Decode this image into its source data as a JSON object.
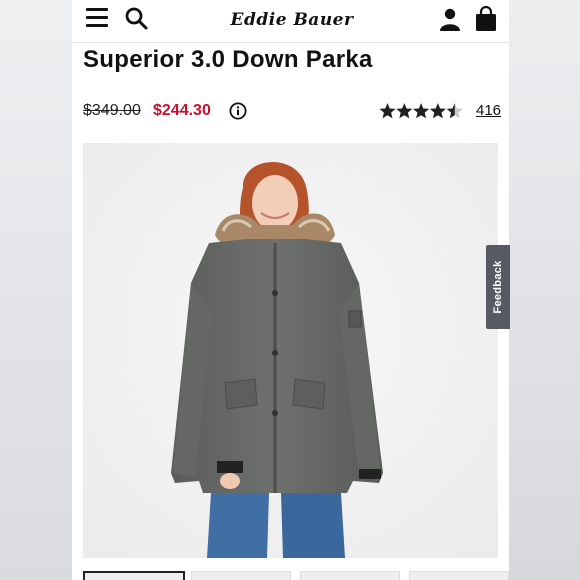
{
  "header": {
    "menu_icon": "hamburger-menu-icon",
    "search_icon": "search-icon",
    "logo_text": "Eddie Bauer",
    "account_icon": "person-icon",
    "bag_icon": "shopping-bag-icon"
  },
  "product": {
    "title": "Superior 3.0 Down Parka",
    "original_price": "$349.00",
    "sale_price": "$244.30",
    "sale_price_color": "#c8102e",
    "info_icon": "info-circle-icon",
    "rating": 4.5,
    "rating_max": 5,
    "review_count": "416",
    "image_subject": "woman wearing gray hooded down parka with faux-fur trim"
  },
  "thumbnails": {
    "count": 4,
    "active_index": 0
  },
  "feedback": {
    "label": "Feedback"
  },
  "colors": {
    "accent_red": "#c8102e",
    "text": "#111111",
    "feedback_bg": "#555b60"
  }
}
